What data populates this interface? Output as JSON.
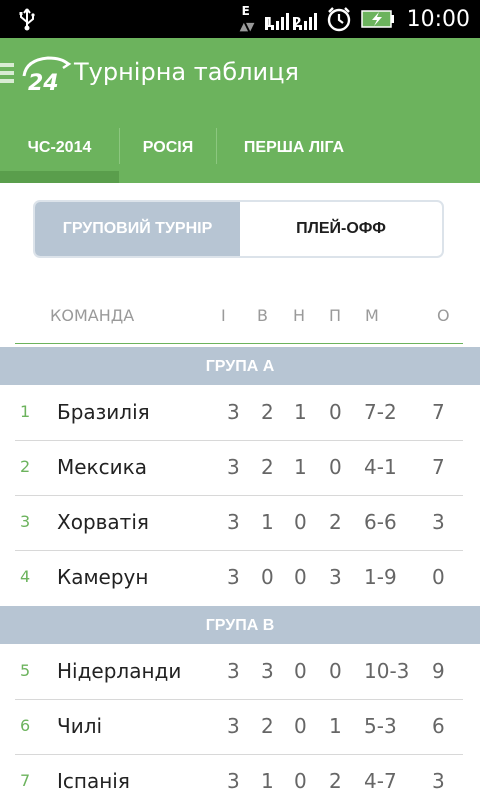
{
  "status_bar": {
    "network_type": "E",
    "signal_1": "1",
    "signal_2": "2",
    "time": "10:00",
    "icons": [
      "usb-icon",
      "network-e-icon",
      "signal-icon",
      "alarm-icon",
      "battery-icon"
    ]
  },
  "app_bar": {
    "logo_text": "24",
    "title": "Турнірна таблиця"
  },
  "tabs": [
    {
      "label": "ЧС-2014",
      "selected": true
    },
    {
      "label": "РОСІЯ",
      "selected": false
    },
    {
      "label": "ПЕРША ЛІГА",
      "selected": false
    }
  ],
  "segments": {
    "group": "ГРУПОВИЙ ТУРНІР",
    "playoff": "ПЛЕЙ-ОФФ",
    "selected": "group"
  },
  "table": {
    "headers": {
      "team": "КОМАНДА",
      "played": "І",
      "won": "В",
      "draw": "Н",
      "lost": "П",
      "goals": "М",
      "points": "О"
    },
    "groups": [
      {
        "name": "ГРУПА А",
        "rows": [
          {
            "pos": "1",
            "team": "Бразилія",
            "played": "3",
            "won": "2",
            "draw": "1",
            "lost": "0",
            "goals": "7-2",
            "points": "7"
          },
          {
            "pos": "2",
            "team": "Мексика",
            "played": "3",
            "won": "2",
            "draw": "1",
            "lost": "0",
            "goals": "4-1",
            "points": "7"
          },
          {
            "pos": "3",
            "team": "Хорватія",
            "played": "3",
            "won": "1",
            "draw": "0",
            "lost": "2",
            "goals": "6-6",
            "points": "3"
          },
          {
            "pos": "4",
            "team": "Камерун",
            "played": "3",
            "won": "0",
            "draw": "0",
            "lost": "3",
            "goals": "1-9",
            "points": "0"
          }
        ]
      },
      {
        "name": "ГРУПА В",
        "rows": [
          {
            "pos": "5",
            "team": "Нідерланди",
            "played": "3",
            "won": "3",
            "draw": "0",
            "lost": "0",
            "goals": "10-3",
            "points": "9"
          },
          {
            "pos": "6",
            "team": "Чилі",
            "played": "3",
            "won": "2",
            "draw": "0",
            "lost": "1",
            "goals": "5-3",
            "points": "6"
          },
          {
            "pos": "7",
            "team": "Іспанія",
            "played": "3",
            "won": "1",
            "draw": "0",
            "lost": "2",
            "goals": "4-7",
            "points": "3"
          }
        ]
      }
    ]
  },
  "colors": {
    "brand_green": "#6cb35d",
    "group_header": "#b7c5d3",
    "position_number": "#6cb35d"
  }
}
